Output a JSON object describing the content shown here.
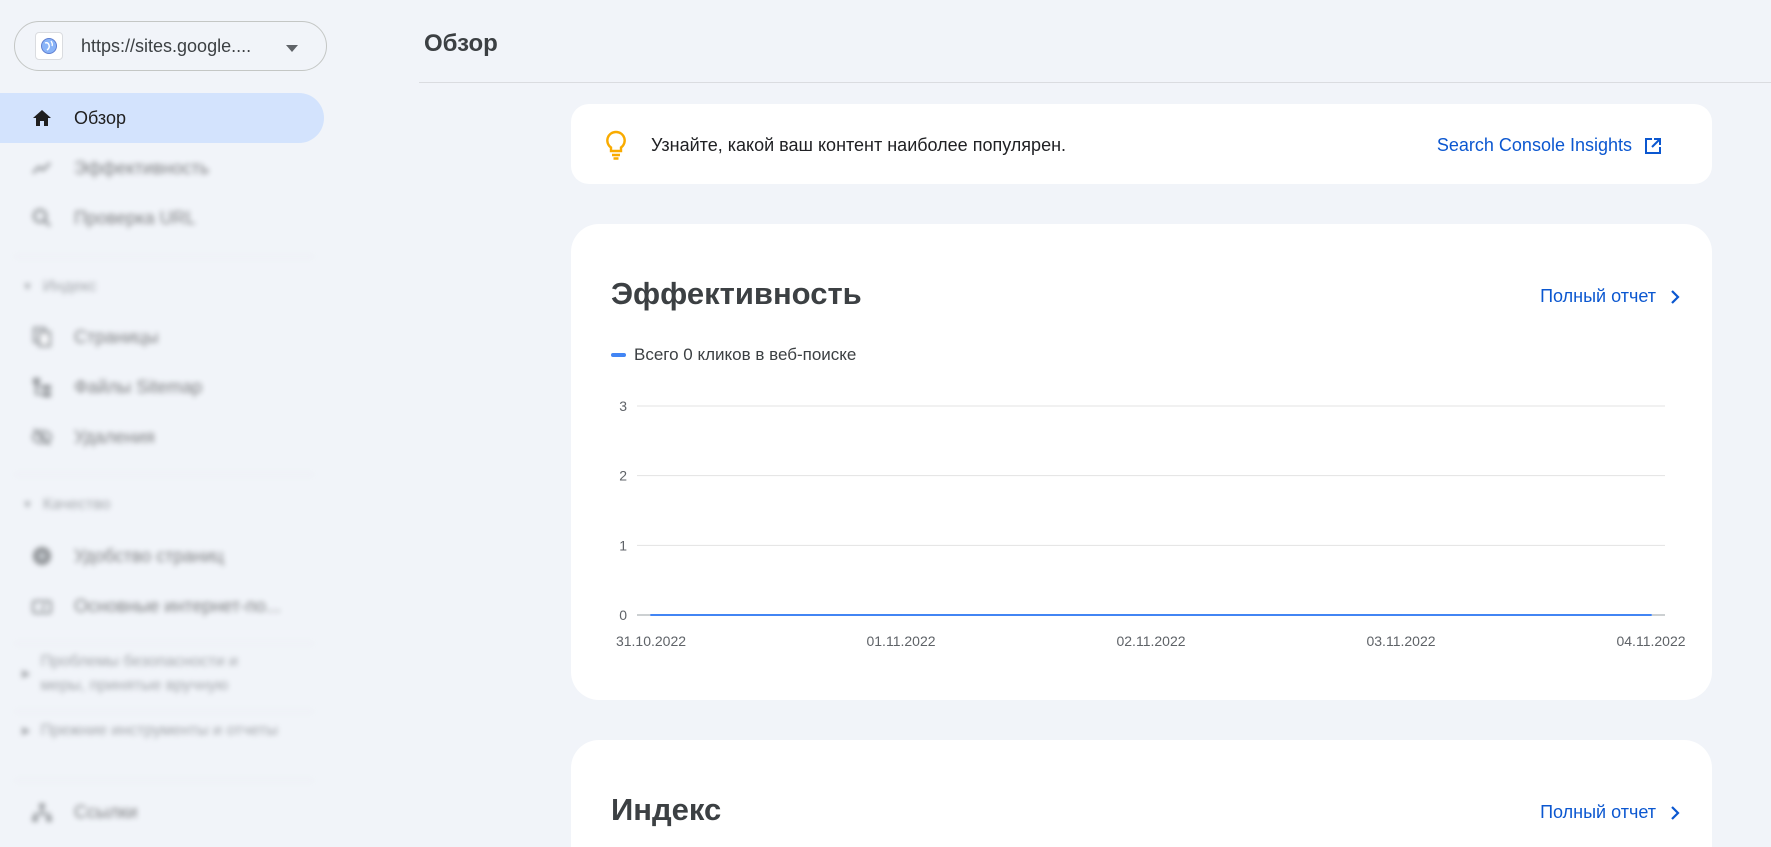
{
  "property": {
    "url": "https://sites.google...."
  },
  "sidebar": {
    "items": [
      {
        "label": "Обзор"
      },
      {
        "label": "Эффективность"
      },
      {
        "label": "Проверка URL"
      },
      {
        "label": "Страницы"
      },
      {
        "label": "Файлы Sitemap"
      },
      {
        "label": "Удаления"
      },
      {
        "label": "Удобство страниц"
      },
      {
        "label": "Основные интернет-по..."
      },
      {
        "label": "Ссылки"
      }
    ],
    "sections": [
      {
        "label": "Индекс"
      },
      {
        "label": "Качество"
      },
      {
        "label": "Проблемы безопасности и меры, принятые вручную"
      },
      {
        "label": "Прежние инструменты и отчеты"
      }
    ]
  },
  "header": {
    "title": "Обзор"
  },
  "insights": {
    "text": "Узнайте, какой ваш контент наиболее популярен.",
    "link": "Search Console Insights"
  },
  "performance": {
    "title": "Эффективность",
    "full_report": "Полный отчет",
    "legend": "Всего 0 кликов в веб-поиске"
  },
  "index": {
    "title": "Индекс",
    "full_report": "Полный отчет"
  },
  "colors": {
    "accent": "#0b57d0",
    "series": "#4285f4",
    "active_nav": "#d3e3fd",
    "bulb": "#f9ab00"
  },
  "chart_data": {
    "type": "line",
    "x": [
      "31.10.2022",
      "01.11.2022",
      "02.11.2022",
      "03.11.2022",
      "04.11.2022"
    ],
    "series": [
      {
        "name": "Всего 0 кликов в веб-поиске",
        "values": [
          0,
          0,
          0,
          0,
          0
        ]
      }
    ],
    "yticks": [
      "0",
      "1",
      "2",
      "3"
    ],
    "ylim": [
      0,
      3
    ],
    "grid": true,
    "title": "",
    "xlabel": "",
    "ylabel": ""
  }
}
